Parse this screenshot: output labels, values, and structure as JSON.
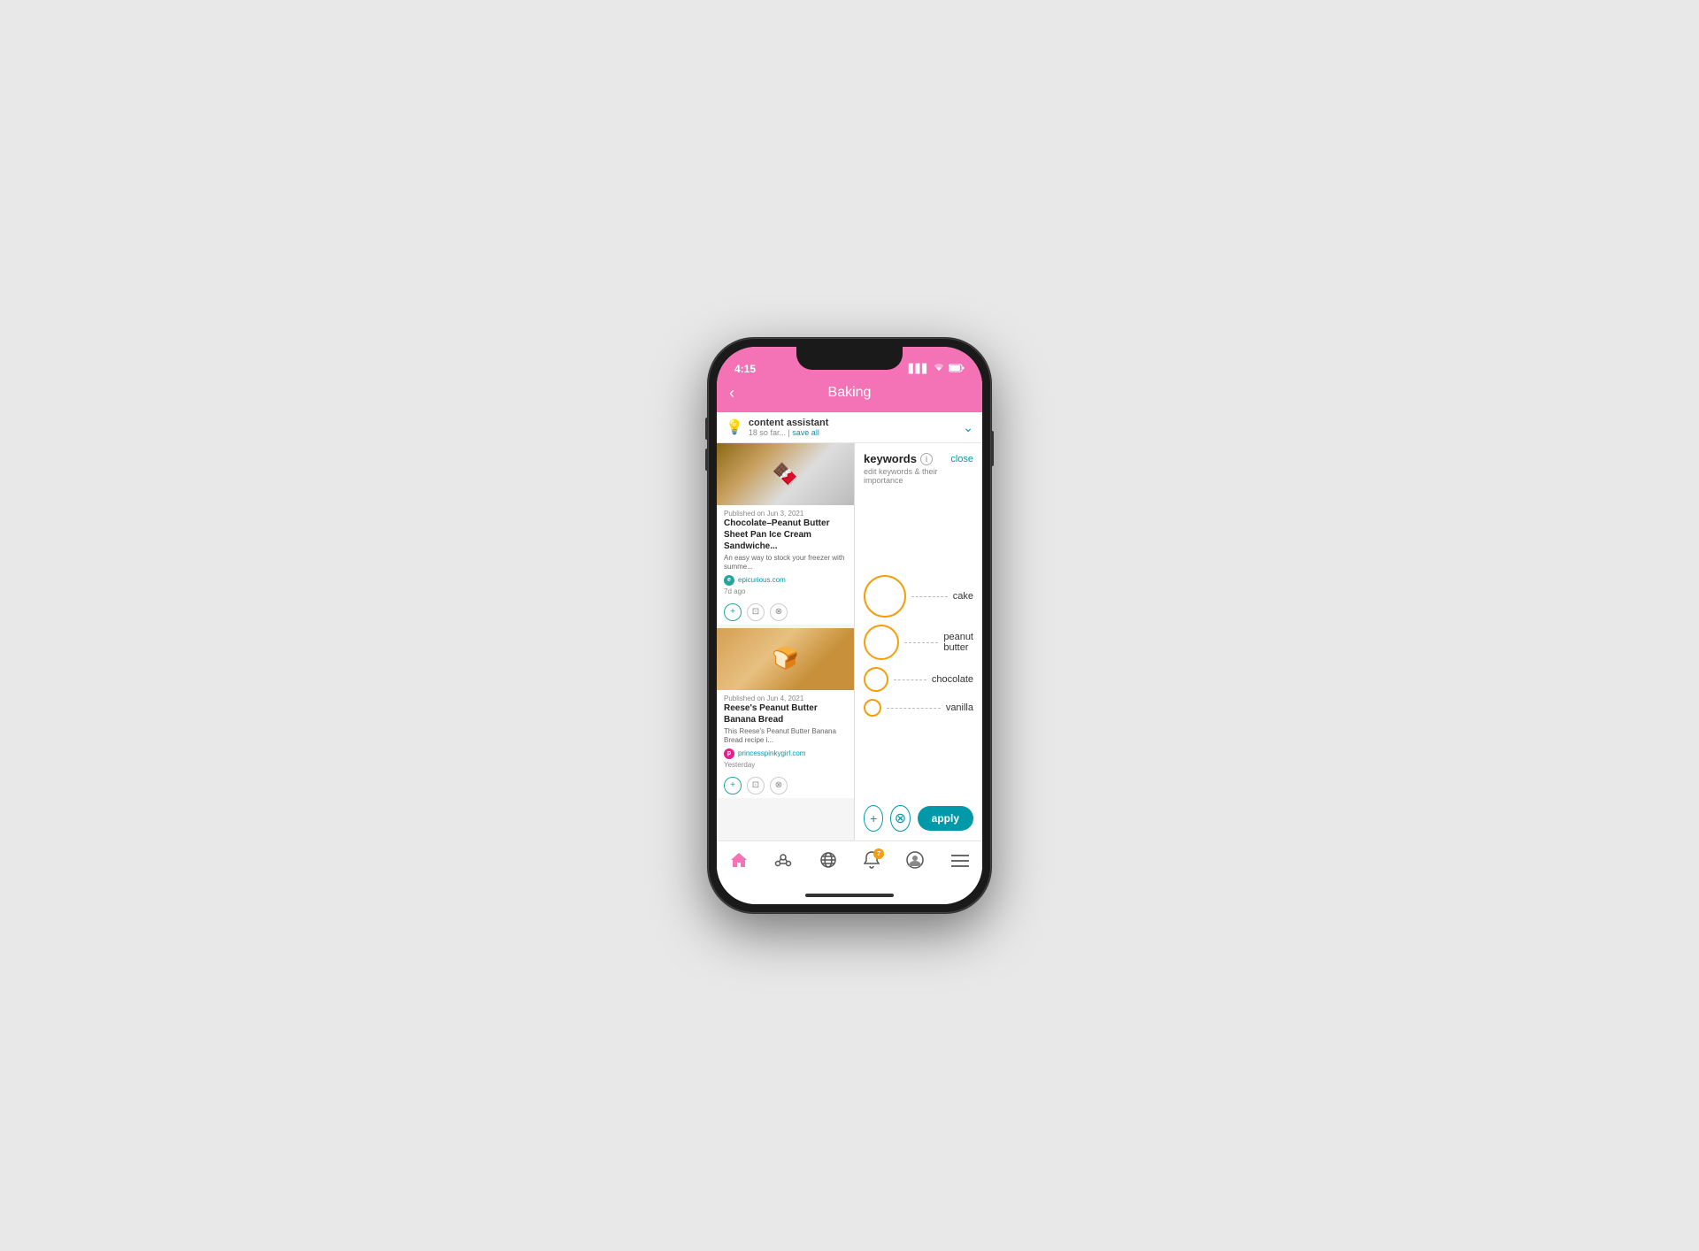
{
  "phone": {
    "status_time": "4:15",
    "signal_icon": "▋▋▋",
    "wifi_icon": "WiFi",
    "battery_icon": "🔋"
  },
  "header": {
    "back_label": "‹",
    "title": "Baking"
  },
  "assistant": {
    "icon": "💡",
    "title": "content assistant",
    "subtitle": "18 so far...",
    "save_link": "save all",
    "chevron": "⌄"
  },
  "keywords": {
    "title": "keywords",
    "info": "i",
    "close_label": "close",
    "subtitle": "edit keywords & their importance",
    "items": [
      {
        "label": "cake",
        "size": "lg"
      },
      {
        "label": "peanut butter",
        "size": "md"
      },
      {
        "label": "chocolate",
        "size": "sm"
      },
      {
        "label": "vanilla",
        "size": "xs"
      }
    ],
    "add_icon": "+",
    "remove_icon": "⊗",
    "apply_label": "apply"
  },
  "articles": [
    {
      "date": "Published on Jun 3, 2021",
      "title": "Chocolate–Peanut Butter Sheet Pan Ice Cream Sandwiche...",
      "desc": "An easy way to stock your freezer with summe...",
      "source": "epicurious.com",
      "source_initial": "e",
      "time": "7d ago"
    },
    {
      "date": "Published on Jun 4, 2021",
      "title": "Reese's Peanut Butter Banana Bread",
      "desc": "This Reese's Peanut Butter Banana Bread recipe i...",
      "source": "princesspinkygirl.com",
      "source_initial": "p",
      "time": "Yesterday"
    }
  ],
  "bottom_nav": [
    {
      "icon": "⌂",
      "name": "home",
      "active": true
    },
    {
      "icon": "⊙",
      "name": "connections",
      "active": false
    },
    {
      "icon": "⊕",
      "name": "globe",
      "active": false
    },
    {
      "icon": "🔔",
      "name": "notifications",
      "active": false,
      "badge": "7"
    },
    {
      "icon": "👤",
      "name": "profile",
      "active": false
    },
    {
      "icon": "≡",
      "name": "menu",
      "active": false
    }
  ]
}
